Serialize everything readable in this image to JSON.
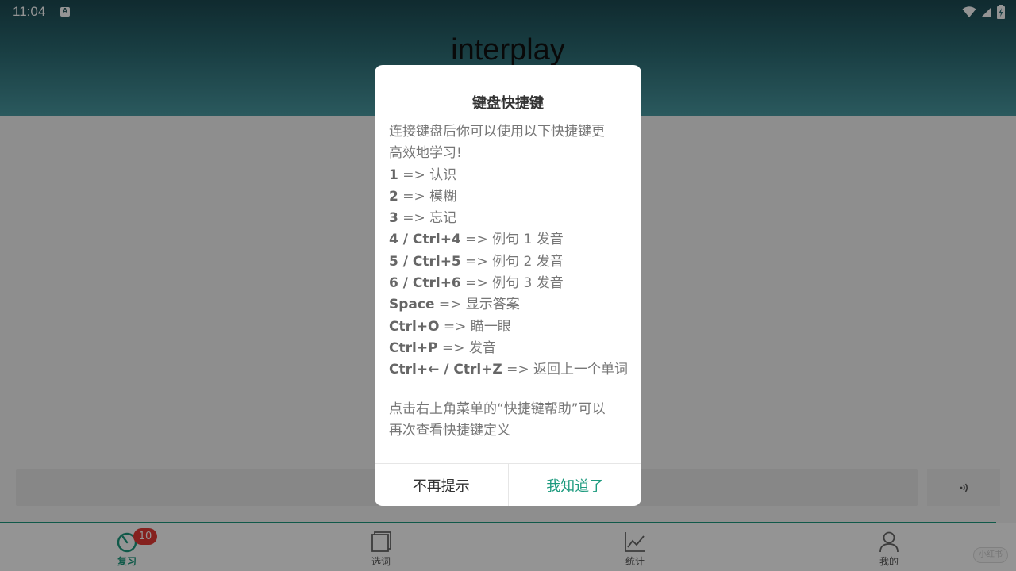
{
  "status_bar": {
    "time": "11:04",
    "notif_letter": "A"
  },
  "header": {
    "word": "interplay"
  },
  "bottom_nav": {
    "items": [
      {
        "label": "复习",
        "icon": "timer-icon",
        "active": true
      },
      {
        "label": "选词",
        "icon": "book-icon",
        "active": false
      },
      {
        "label": "统计",
        "icon": "chart-icon",
        "active": false
      },
      {
        "label": "我的",
        "icon": "person-icon",
        "active": false
      }
    ],
    "review_badge": "10"
  },
  "watermark": "小红书",
  "dialog": {
    "title": "键盘快捷键",
    "intro": [
      "连接键盘后你可以使用以下快捷键更",
      "高效地学习!"
    ],
    "shortcuts": [
      {
        "key": "1",
        "action": "认识"
      },
      {
        "key": "2",
        "action": "模糊"
      },
      {
        "key": "3",
        "action": "忘记"
      },
      {
        "key": "4 / Ctrl+4",
        "action": "例句 1 发音"
      },
      {
        "key": "5 / Ctrl+5",
        "action": "例句 2 发音"
      },
      {
        "key": "6 / Ctrl+6",
        "action": "例句 3 发音"
      },
      {
        "key": "Space",
        "action": "显示答案"
      },
      {
        "key": "Ctrl+O",
        "action": "瞄一眼"
      },
      {
        "key": "Ctrl+P",
        "action": "发音"
      },
      {
        "key": "Ctrl+← / Ctrl+Z",
        "action": "返回上一个单词"
      }
    ],
    "arrow": "=>",
    "footer_note": [
      "点击右上角菜单的“快捷键帮助”可以",
      "再次查看快捷键定义"
    ],
    "dismiss_label": "不再提示",
    "confirm_label": "我知道了"
  },
  "colors": {
    "accent": "#1c9a7e",
    "badge": "#e53935",
    "header_top": "#1c4a52",
    "header_bottom": "#4a9aa2"
  }
}
